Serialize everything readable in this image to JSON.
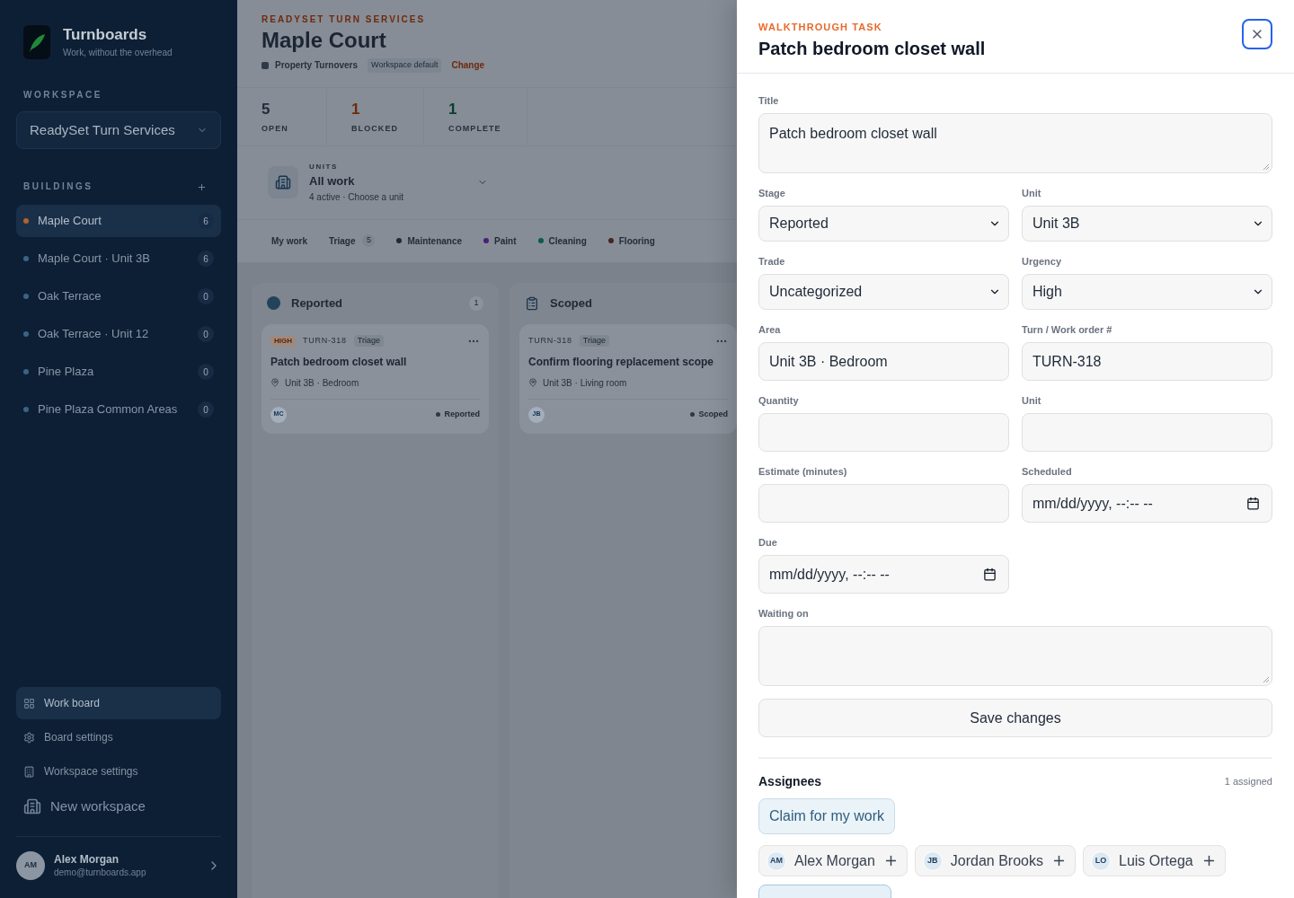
{
  "sidebar": {
    "brand": {
      "name": "Turnboards",
      "tagline": "Work, without the overhead"
    },
    "workspace": {
      "label": "WORKSPACE",
      "value": "ReadySet Turn Services"
    },
    "buildings": {
      "label": "BUILDINGS",
      "items": [
        {
          "name": "Maple Court",
          "count": "6",
          "selected": true
        },
        {
          "name": "Maple Court · Unit 3B",
          "count": "6",
          "selected": false
        },
        {
          "name": "Oak Terrace",
          "count": "0",
          "selected": false
        },
        {
          "name": "Oak Terrace · Unit 12",
          "count": "0",
          "selected": false
        },
        {
          "name": "Pine Plaza",
          "count": "0",
          "selected": false
        },
        {
          "name": "Pine Plaza Common Areas",
          "count": "0",
          "selected": false
        }
      ]
    },
    "nav": [
      {
        "label": "Work board",
        "kind": "link",
        "selected": true
      },
      {
        "label": "Board settings",
        "kind": "link",
        "selected": false
      },
      {
        "label": "Workspace settings",
        "kind": "link",
        "selected": false
      },
      {
        "label": "New workspace",
        "kind": "action",
        "selected": false
      }
    ],
    "user": {
      "initials": "AM",
      "name": "Alex Morgan",
      "email": "demo@turnboards.app"
    }
  },
  "header": {
    "eyebrow": "READYSET TURN SERVICES",
    "title": "Maple Court",
    "template": "Property Turnovers",
    "badge": "Workspace default",
    "link": "Change"
  },
  "stats": [
    {
      "value": "5",
      "label": "OPEN",
      "color": "#1f2a38"
    },
    {
      "value": "1",
      "label": "BLOCKED",
      "color": "#6e2a0c"
    },
    {
      "value": "1",
      "label": "COMPLETE",
      "color": "#0b3f2e"
    }
  ],
  "units": {
    "label": "UNITS",
    "value": "All work",
    "hint": "4 active · Choose a unit"
  },
  "filters": [
    {
      "kind": "view",
      "label": "My work"
    },
    {
      "kind": "view",
      "label": "Triage",
      "count": "5"
    },
    {
      "kind": "trade",
      "label": "Maintenance",
      "color": "#1e293b"
    },
    {
      "kind": "trade",
      "label": "Paint",
      "color": "#4c1d75"
    },
    {
      "kind": "trade",
      "label": "Cleaning",
      "color": "#0b5a4a"
    },
    {
      "kind": "trade",
      "label": "Flooring",
      "color": "#452620"
    }
  ],
  "columns": [
    {
      "title": "Reported",
      "count": "1",
      "cards": [
        {
          "priority": "HIGH",
          "ref": "TURN-318",
          "tag": "Triage",
          "title": "Patch bedroom closet wall",
          "location": "Unit 3B · Bedroom",
          "assignee": "MC",
          "status": "Reported"
        }
      ]
    },
    {
      "title": "Scoped",
      "cards": [
        {
          "ref": "TURN-318",
          "tag": "Triage",
          "title": "Confirm flooring replacement scope",
          "location": "Unit 3B · Living room",
          "assignee": "JB",
          "status": "Scoped"
        }
      ]
    }
  ],
  "drawer": {
    "eyebrow": "WALKTHROUGH TASK",
    "title": "Patch bedroom closet wall",
    "fields": [
      {
        "label": "Title",
        "kind": "textarea",
        "value": "Patch bedroom closet wall"
      },
      {
        "label": "Stage",
        "kind": "select",
        "value": "Reported"
      },
      {
        "label": "Unit",
        "kind": "select",
        "value": "Unit 3B"
      },
      {
        "label": "Trade",
        "kind": "select",
        "value": "Uncategorized"
      },
      {
        "label": "Urgency",
        "kind": "select",
        "value": "High"
      },
      {
        "label": "Area",
        "kind": "text",
        "value": "Unit 3B · Bedroom"
      },
      {
        "label": "Turn / Work order #",
        "kind": "text",
        "value": "TURN-318"
      },
      {
        "label": "Quantity",
        "kind": "text"
      },
      {
        "label": "Unit",
        "kind": "text"
      },
      {
        "label": "Estimate (minutes)",
        "kind": "text"
      },
      {
        "label": "Scheduled",
        "kind": "date",
        "placeholder": "mm/dd/yyyy, --:-- --"
      },
      {
        "label": "Due",
        "kind": "date",
        "placeholder": "mm/dd/yyyy, --:-- --"
      },
      {
        "label": "Waiting on",
        "kind": "textarea"
      }
    ],
    "save": "Save changes",
    "assignees": {
      "title": "Assignees",
      "summary": "1 assigned",
      "claim": "Claim for my work",
      "people": [
        {
          "initials": "AM",
          "name": "Alex Morgan",
          "selected": false
        },
        {
          "initials": "JB",
          "name": "Jordan Brooks",
          "selected": false
        },
        {
          "initials": "LO",
          "name": "Luis Ortega",
          "selected": false
        },
        {
          "selected": true
        }
      ]
    }
  }
}
